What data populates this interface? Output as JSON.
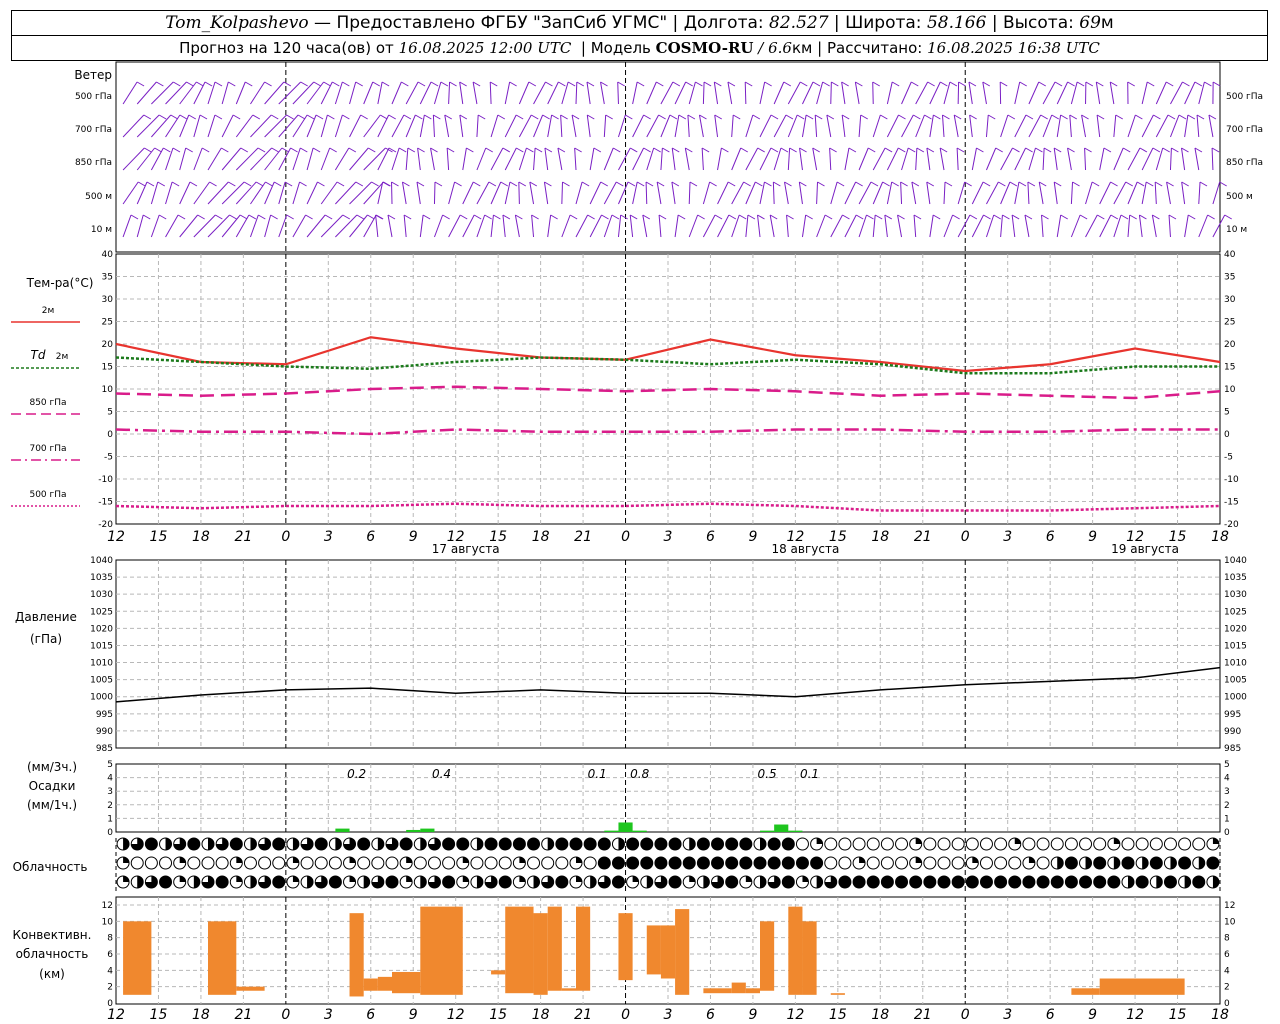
{
  "header": {
    "station": "Tom_Kolpashevo",
    "provider": "— Предоставлено ФГБУ \"ЗапСиб УГМС\"",
    "lon_label": "Долгота:",
    "lon": "82.527",
    "lat_label": "Широта:",
    "lat": "58.166",
    "alt_label": "Высота:",
    "alt": "69",
    "alt_unit": "м",
    "forecast_label": "Прогноз на 120 часа(ов) от",
    "forecast_from": "16.08.2025 12:00 UTC",
    "model_label": "Модель",
    "model": "COSMO-RU",
    "resolution": "/ 6.6",
    "res_unit": "км",
    "calc_label": "Рассчитано:",
    "calc_time": "16.08.2025 16:38 UTC",
    "sep": "|"
  },
  "labels": {
    "wind": "Ветер",
    "wind_levels": [
      "500 гПа",
      "700 гПа",
      "850 гПа",
      "500  м",
      "10   м"
    ],
    "temp_title": "Тем-ра(°С)",
    "t2m": "2м",
    "td_symbol": "Td",
    "td2m": "2м",
    "t850": "850 гПа",
    "t700": "700 гПа",
    "t500": "500 гПа",
    "pressure": "Давление",
    "pressure_unit": "(гПа)",
    "precip_unit3": "(мм/3ч.)",
    "precip": "Осадки",
    "precip_unit1": "(мм/1ч.)",
    "cloud": "Облачность",
    "conv1": "Конвективн.",
    "conv2": "облачность",
    "conv3": "(км)"
  },
  "chart_data": {
    "type": "line",
    "x_hour_labels": [
      "12",
      "15",
      "18",
      "21",
      "0",
      "3",
      "6",
      "9",
      "12",
      "15",
      "18",
      "21",
      "0",
      "3",
      "6",
      "9",
      "12",
      "15",
      "18",
      "21",
      "0",
      "3",
      "6",
      "9",
      "12",
      "15",
      "18"
    ],
    "day_labels": [
      {
        "text": "17 августа",
        "at_hour": 24
      },
      {
        "text": "18 августа",
        "at_hour": 48
      },
      {
        "text": "19 августа",
        "at_hour": 72
      }
    ],
    "x_hours": [
      0,
      6,
      12,
      18,
      24,
      30,
      36,
      42,
      48,
      54,
      60,
      66,
      72,
      78
    ],
    "temperature": {
      "ylim": [
        -20,
        40
      ],
      "ticks": [
        -20,
        -15,
        -10,
        -5,
        0,
        5,
        10,
        15,
        20,
        25,
        30,
        35,
        40
      ],
      "series": [
        {
          "name": "2м",
          "color": "#e8342e",
          "values": [
            20,
            16,
            15.5,
            21.5,
            19,
            17,
            16.5,
            21,
            17.5,
            16,
            14,
            15.5,
            19,
            16
          ]
        },
        {
          "name": "Td 2м",
          "color": "#1b7a1b",
          "values": [
            17,
            16,
            15,
            14.5,
            16,
            17,
            16.5,
            15.5,
            16.5,
            15.5,
            13.5,
            13.5,
            15,
            15
          ]
        },
        {
          "name": "850 гПа",
          "color": "#d91c8a",
          "values": [
            9,
            8.5,
            9,
            10,
            10.5,
            10,
            9.5,
            10,
            9.5,
            8.5,
            9,
            8.5,
            8,
            9.5
          ]
        },
        {
          "name": "700 гПа",
          "color": "#d91c8a",
          "values": [
            1,
            0.5,
            0.5,
            0,
            1,
            0.5,
            0.5,
            0.5,
            1,
            1,
            0.5,
            0.5,
            1,
            1
          ]
        },
        {
          "name": "500 гПа",
          "color": "#d91c8a",
          "values": [
            -16,
            -16.5,
            -16,
            -16,
            -15.5,
            -16,
            -16,
            -15.5,
            -16,
            -17,
            -17,
            -17,
            -16.5,
            -16
          ]
        }
      ]
    },
    "pressure": {
      "ylim": [
        985,
        1040
      ],
      "ticks": [
        985,
        990,
        995,
        1000,
        1005,
        1010,
        1015,
        1020,
        1025,
        1030,
        1035,
        1040
      ],
      "values": [
        998.5,
        1000.5,
        1002,
        1002.5,
        1001,
        1002,
        1001,
        1001,
        1000,
        1002,
        1003.5,
        1004.5,
        1005.5,
        1008.5
      ]
    },
    "precipitation": {
      "ylim": [
        0,
        5
      ],
      "ticks": [
        0,
        1,
        2,
        3,
        4,
        5
      ],
      "labels_3h": [
        {
          "text": "0.2",
          "at_hour": 17
        },
        {
          "text": "0.4",
          "at_hour": 23
        },
        {
          "text": "0.1",
          "at_hour": 34
        },
        {
          "text": "0.8",
          "at_hour": 37
        },
        {
          "text": "0.5",
          "at_hour": 46
        },
        {
          "text": "0.1",
          "at_hour": 49
        }
      ],
      "hourly": [
        {
          "at_hour": 16,
          "value": 0.25
        },
        {
          "at_hour": 21,
          "value": 0.15
        },
        {
          "at_hour": 22,
          "value": 0.25
        },
        {
          "at_hour": 35,
          "value": 0.1
        },
        {
          "at_hour": 36,
          "value": 0.7
        },
        {
          "at_hour": 37,
          "value": 0.1
        },
        {
          "at_hour": 46,
          "value": 0.1
        },
        {
          "at_hour": 47,
          "value": 0.55
        },
        {
          "at_hour": 48,
          "value": 0.1
        }
      ]
    },
    "convective_cloud": {
      "ylim": [
        0,
        13
      ],
      "ticks": [
        0,
        2,
        4,
        6,
        8,
        10,
        12
      ],
      "bars": [
        {
          "from": 0.5,
          "to": 2.5,
          "base": 1,
          "top": 10
        },
        {
          "from": 6.5,
          "to": 8.5,
          "base": 1,
          "top": 10
        },
        {
          "from": 8.5,
          "to": 10.5,
          "base": 1.5,
          "top": 2
        },
        {
          "from": 16.5,
          "to": 17.5,
          "base": 0.8,
          "top": 11
        },
        {
          "from": 17.5,
          "to": 18.5,
          "base": 1.5,
          "top": 3
        },
        {
          "from": 18.5,
          "to": 19.5,
          "base": 1.5,
          "top": 3.2
        },
        {
          "from": 19.5,
          "to": 21.5,
          "base": 1.2,
          "top": 3.8
        },
        {
          "from": 21.5,
          "to": 24.5,
          "base": 1,
          "top": 11.8
        },
        {
          "from": 26.5,
          "to": 27.5,
          "base": 3.5,
          "top": 4
        },
        {
          "from": 27.5,
          "to": 29.5,
          "base": 1.2,
          "top": 11.8
        },
        {
          "from": 29.5,
          "to": 30.5,
          "base": 1,
          "top": 11
        },
        {
          "from": 30.5,
          "to": 31.5,
          "base": 1.5,
          "top": 11.8
        },
        {
          "from": 31.5,
          "to": 32.5,
          "base": 1.5,
          "top": 1.8
        },
        {
          "from": 32.5,
          "to": 33.5,
          "base": 1.5,
          "top": 11.8
        },
        {
          "from": 35.5,
          "to": 36.5,
          "base": 2.8,
          "top": 11
        },
        {
          "from": 37.5,
          "to": 38.5,
          "base": 3.5,
          "top": 9.5
        },
        {
          "from": 38.5,
          "to": 39.5,
          "base": 3,
          "top": 9.5
        },
        {
          "from": 39.5,
          "to": 40.5,
          "base": 1,
          "top": 11.5
        },
        {
          "from": 41.5,
          "to": 43.5,
          "base": 1.2,
          "top": 1.8
        },
        {
          "from": 43.5,
          "to": 44.5,
          "base": 1.2,
          "top": 2.5
        },
        {
          "from": 44.5,
          "to": 45.5,
          "base": 1.2,
          "top": 1.8
        },
        {
          "from": 45.5,
          "to": 46.5,
          "base": 1.5,
          "top": 10
        },
        {
          "from": 47.5,
          "to": 48.5,
          "base": 1,
          "top": 11.8
        },
        {
          "from": 48.5,
          "to": 49.5,
          "base": 1,
          "top": 10
        },
        {
          "from": 50.5,
          "to": 51.5,
          "base": 1,
          "top": 1.2
        },
        {
          "from": 67.5,
          "to": 69.5,
          "base": 1,
          "top": 1.8
        },
        {
          "from": 69.5,
          "to": 75.5,
          "base": 1,
          "top": 3
        }
      ]
    },
    "cloud_cover": {
      "rows": 3,
      "columns": 78,
      "legend": "0=clear, 1=quarter, 2=half, 3=three-quarter, 4=overcast"
    },
    "colors": {
      "t2m": "#e8342e",
      "td": "#1b7a1b",
      "pink": "#d91c8a",
      "wind": "#7a1fc4",
      "precip": "#1ec51e",
      "conv": "#f0882e"
    }
  }
}
